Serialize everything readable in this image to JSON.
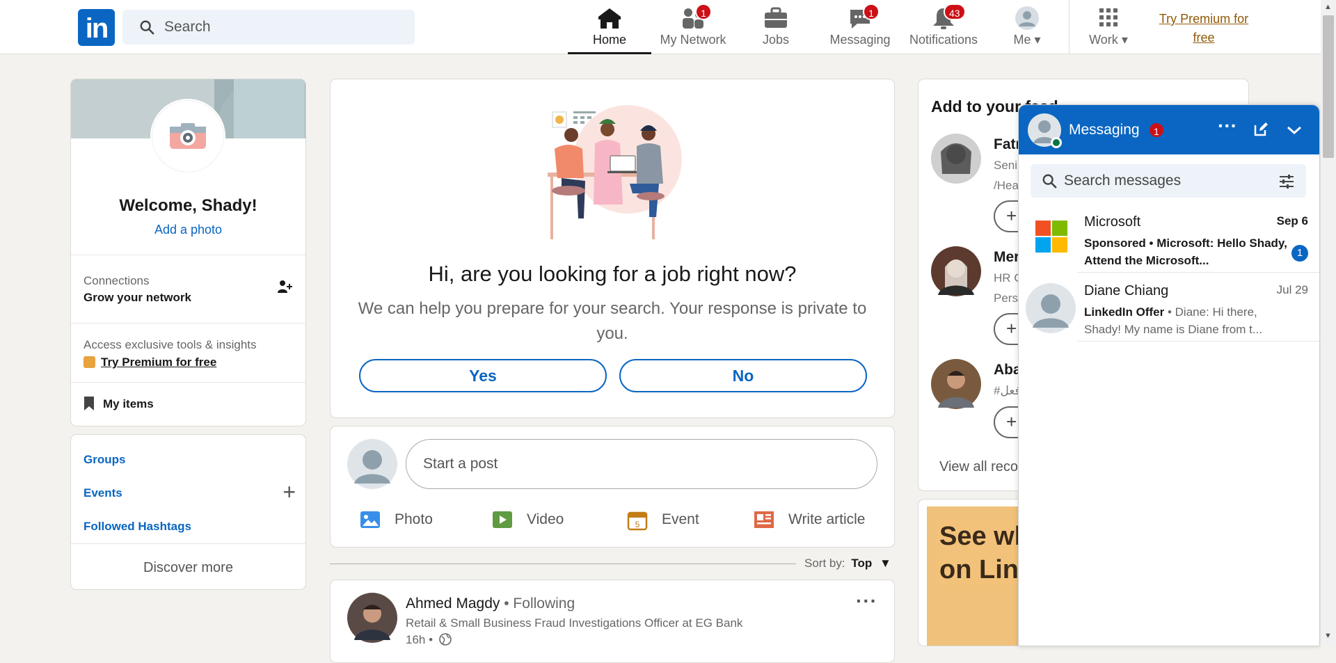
{
  "colors": {
    "brand": "#0a66c2",
    "badge": "#cc1016",
    "premium": "#915907",
    "background": "#f4f2ee"
  },
  "header": {
    "logo": "in",
    "search_placeholder": "Search",
    "nav": [
      {
        "label": "Home",
        "icon": "home-icon"
      },
      {
        "label": "My Network",
        "icon": "network-icon",
        "badge": "1"
      },
      {
        "label": "Jobs",
        "icon": "briefcase-icon"
      },
      {
        "label": "Messaging",
        "icon": "chat-icon",
        "badge": "1"
      },
      {
        "label": "Notifications",
        "icon": "bell-icon",
        "badge": "43"
      },
      {
        "label": "Me",
        "icon": "avatar-icon"
      },
      {
        "label": "Work",
        "icon": "grid-icon"
      }
    ],
    "premium": "Try Premium for free"
  },
  "profile": {
    "welcome": "Welcome, Shady!",
    "add_photo": "Add a photo",
    "connections_label": "Connections",
    "connections_sub": "Grow your network",
    "premium_teaser": "Access exclusive tools & insights",
    "premium_link": "Try Premium for free",
    "my_items": "My items"
  },
  "community": {
    "groups": "Groups",
    "events": "Events",
    "hashtags": "Followed Hashtags",
    "discover": "Discover more"
  },
  "job_prompt": {
    "title": "Hi, are you looking for a job right now?",
    "body": "We can help you prepare for your search. Your response is private to you.",
    "yes": "Yes",
    "no": "No"
  },
  "composer": {
    "placeholder": "Start a post",
    "actions": [
      "Photo",
      "Video",
      "Event",
      "Write article"
    ]
  },
  "sort": {
    "label": "Sort by:",
    "value": "Top"
  },
  "post": {
    "author": "Ahmed Magdy",
    "following": "• Following",
    "headline": "Retail & Small Business Fraud Investigations Officer at EG Bank",
    "time": "16h •"
  },
  "feed_suggestions": {
    "title": "Add to your feed",
    "people": [
      {
        "name": "Fatr",
        "l1": "Seni",
        "l2": "/Hea"
      },
      {
        "name": "Mer",
        "l1": "HR C",
        "l2": "Perso"
      },
      {
        "name": "Aba",
        "l1": "#فعل",
        "l2": ""
      }
    ],
    "view_all": "View all reco"
  },
  "ad": {
    "line1": "See wh",
    "line2": "on Link"
  },
  "messaging": {
    "title": "Messaging",
    "badge": "1",
    "search_placeholder": "Search messages",
    "conversations": [
      {
        "name": "Microsoft",
        "date": "Sep 6",
        "tag": "Sponsored",
        "preview": "Microsoft: Hello Shady, Attend the Microsoft...",
        "unread": "1"
      },
      {
        "name": "Diane Chiang",
        "date": "Jul 29",
        "tag": "LinkedIn Offer",
        "preview": "Diane: Hi there, Shady! My name is Diane from t..."
      }
    ]
  }
}
